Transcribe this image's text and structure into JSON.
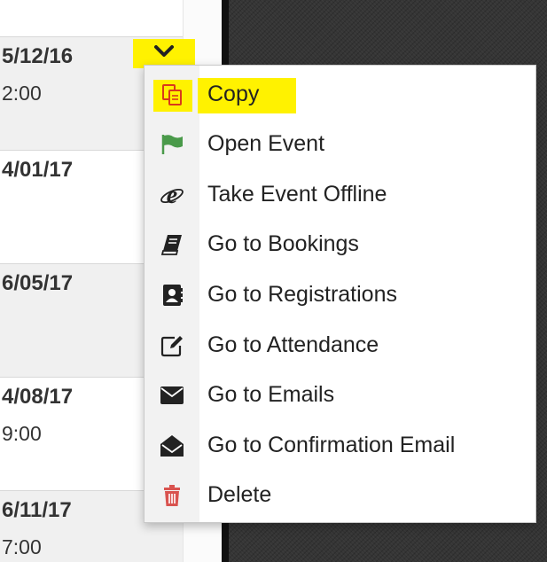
{
  "rows": [
    {
      "date": "5/12/16",
      "time": "2:00"
    },
    {
      "date": "4/01/17",
      "time": ""
    },
    {
      "date": "6/05/17",
      "time": ""
    },
    {
      "date": "4/08/17",
      "time": "9:00"
    },
    {
      "date": "6/11/17",
      "time": "7:00"
    }
  ],
  "toggle": {
    "icon": "chevron-down-icon"
  },
  "menu": {
    "items": [
      {
        "label": "Copy",
        "icon": "copy-icon",
        "color": "#d93a1b",
        "highlighted": true
      },
      {
        "label": "Open Event",
        "icon": "flag-icon",
        "color": "#4a9a4a"
      },
      {
        "label": "Take Event Offline",
        "icon": "internet-explorer-icon",
        "color": "#222222"
      },
      {
        "label": "Go to Bookings",
        "icon": "book-icon",
        "color": "#222222"
      },
      {
        "label": "Go to Registrations",
        "icon": "contact-book-icon",
        "color": "#222222"
      },
      {
        "label": "Go to Attendance",
        "icon": "edit-icon",
        "color": "#222222"
      },
      {
        "label": "Go to Emails",
        "icon": "envelope-icon",
        "color": "#222222"
      },
      {
        "label": "Go to Confirmation Email",
        "icon": "envelope-open-icon",
        "color": "#222222"
      },
      {
        "label": "Delete",
        "icon": "trash-icon",
        "color": "#d9534f"
      }
    ]
  },
  "colors": {
    "highlight": "#fff200",
    "dark_background": "#353535"
  }
}
